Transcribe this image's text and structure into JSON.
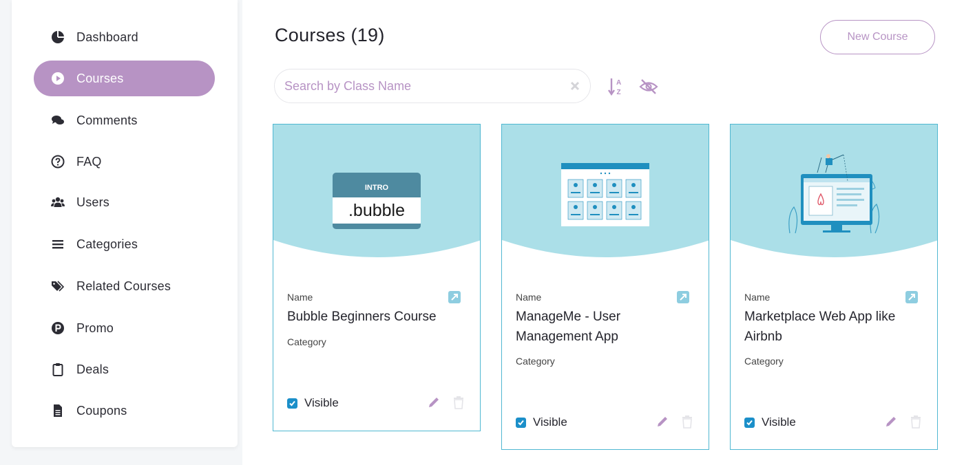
{
  "sidebar": {
    "items": [
      {
        "label": "Dashboard",
        "icon": "pie-chart-icon",
        "active": false
      },
      {
        "label": "Courses",
        "icon": "play-circle-icon",
        "active": true
      },
      {
        "label": "Comments",
        "icon": "comments-icon",
        "active": false
      },
      {
        "label": "FAQ",
        "icon": "question-circle-icon",
        "active": false
      },
      {
        "label": "Users",
        "icon": "users-icon",
        "active": false
      },
      {
        "label": "Categories",
        "icon": "list-icon",
        "active": false
      },
      {
        "label": "Related Courses",
        "icon": "tags-icon",
        "active": false
      },
      {
        "label": "Promo",
        "icon": "promo-p-icon",
        "active": false
      },
      {
        "label": "Deals",
        "icon": "clipboard-icon",
        "active": false
      },
      {
        "label": "Coupons",
        "icon": "document-icon",
        "active": false
      }
    ]
  },
  "header": {
    "title": "Courses (19)",
    "new_button": "New Course"
  },
  "search": {
    "placeholder": "Search by Class Name",
    "value": ""
  },
  "toolbar": {
    "sort_icon": "sort-alpha-icon",
    "visibility_icon": "eye-slash-icon"
  },
  "cards": [
    {
      "name_label": "Name",
      "name": "Bubble Beginners Course",
      "category_label": "Category",
      "visible_label": "Visible",
      "visible": true,
      "badge_top": "INTRO",
      "badge_main": ".bubble"
    },
    {
      "name_label": "Name",
      "name": "ManageMe - User Management App",
      "category_label": "Category",
      "visible_label": "Visible",
      "visible": true
    },
    {
      "name_label": "Name",
      "name": "Marketplace Web App like Airbnb",
      "category_label": "Category",
      "visible_label": "Visible",
      "visible": true
    }
  ],
  "colors": {
    "accent": "#b793c4",
    "card_border": "#4fb7d1",
    "card_hero": "#abdfe8",
    "checkbox": "#1b8fc9"
  }
}
